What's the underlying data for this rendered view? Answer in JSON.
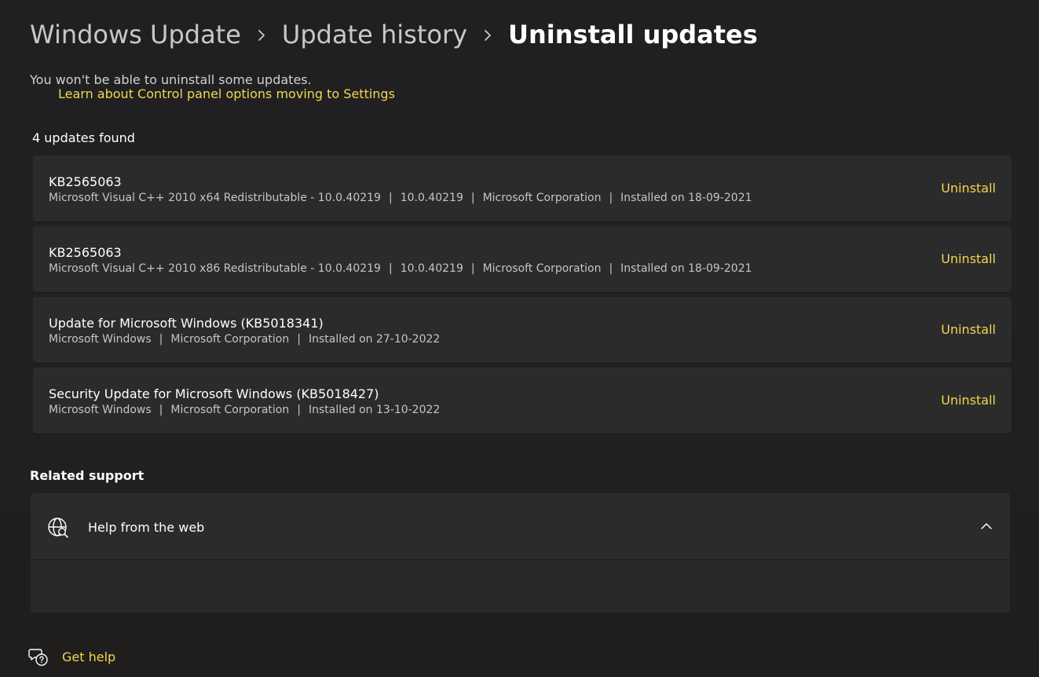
{
  "breadcrumb": {
    "items": [
      "Windows Update",
      "Update history",
      "Uninstall updates"
    ]
  },
  "subtitle": "You won't be able to uninstall some updates.",
  "updates_count": "4 updates found",
  "updates": [
    {
      "title": "KB2565063",
      "meta": [
        "Microsoft Visual C++ 2010  x64 Redistributable - 10.0.40219",
        "10.0.40219",
        "Microsoft Corporation",
        "Installed on 18-09-2021"
      ],
      "action": "Uninstall"
    },
    {
      "title": "KB2565063",
      "meta": [
        "Microsoft Visual C++ 2010  x86 Redistributable - 10.0.40219",
        "10.0.40219",
        "Microsoft Corporation",
        "Installed on 18-09-2021"
      ],
      "action": "Uninstall"
    },
    {
      "title": "Update for Microsoft Windows (KB5018341)",
      "meta": [
        "Microsoft Windows",
        "Microsoft Corporation",
        "Installed on 27-10-2022"
      ],
      "action": "Uninstall"
    },
    {
      "title": "Security Update for Microsoft Windows (KB5018427)",
      "meta": [
        "Microsoft Windows",
        "Microsoft Corporation",
        "Installed on 13-10-2022"
      ],
      "action": "Uninstall"
    }
  ],
  "related_support": {
    "heading": "Related support",
    "card_title": "Help from the web",
    "link": "Learn about Control panel options moving to Settings",
    "icon": "globe-search-icon",
    "expanded": true
  },
  "get_help": {
    "label": "Get help",
    "icon": "help-chat-icon"
  },
  "colors": {
    "background": "#202020",
    "card": "#2b2b2b",
    "accent": "#f3d64f",
    "text_primary": "#ffffff",
    "text_secondary": "#c5c5c5"
  }
}
